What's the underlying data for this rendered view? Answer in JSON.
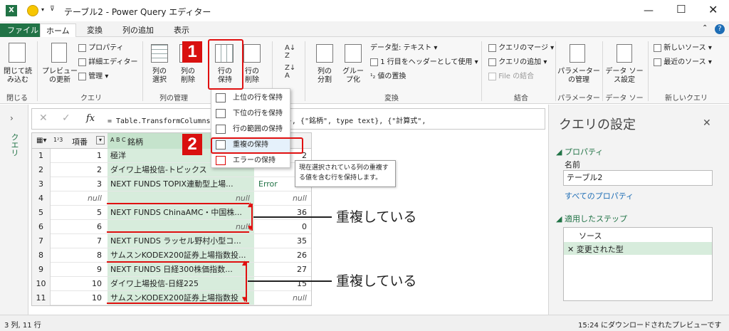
{
  "window": {
    "title": "テーブル2 - Power Query エディター"
  },
  "tabs": [
    "ファイル",
    "ホーム",
    "変換",
    "列の追加",
    "表示"
  ],
  "ribbon": {
    "close_load": "閉じて読\nみ込む",
    "preview": "プレビュー\nの更新",
    "properties": "プロパティ",
    "advanced_editor": "詳細エディター",
    "manage": "管理",
    "choose_cols": "列の\n選択",
    "remove_cols": "列の\n削除",
    "keep_rows": "行の\n保持",
    "remove_rows": "行の\n削除",
    "split_col": "列の\n分割",
    "group_by": "グルー\nプ化",
    "data_type": "データ型: テキスト",
    "first_row_header": "1 行目をヘッダーとして使用",
    "replace_values": "値の置換",
    "merge_queries": "クエリのマージ",
    "append_queries": "クエリの追加",
    "combine_files": "File の結合",
    "param_manage": "パラメーター\nの管理",
    "data_source": "データ ソー\nス設定",
    "new_source": "新しいソース",
    "recent_sources": "最近のソース",
    "groups": {
      "close": "閉じる",
      "query": "クエリ",
      "col_manage": "列の管理",
      "transform": "変換",
      "combine": "結合",
      "param": "パラメーター",
      "datasource": "データ ソース",
      "newquery": "新しいクエリ"
    }
  },
  "formula": {
    "fx": "fx",
    "text": "= Table.TransformColumns(... \", Int64.Type}, {\"銘柄\", type text}, {\"計算式\","
  },
  "nav_label": "クエリ",
  "grid": {
    "headers": [
      "項番",
      "銘柄"
    ],
    "header_types": [
      "1²3",
      "A B C"
    ],
    "rows": [
      {
        "num": "1",
        "c1": "1",
        "c2": "極洋",
        "c3": "2"
      },
      {
        "num": "2",
        "c1": "2",
        "c2": "ダイワ上場投信-トピックス",
        "c3": ""
      },
      {
        "num": "3",
        "c1": "3",
        "c2": "NEXT FUNDS TOPIX連動型上場...",
        "c3": "Error"
      },
      {
        "num": "4",
        "c1": "null",
        "c2": "null",
        "c3": "null"
      },
      {
        "num": "5",
        "c1": "5",
        "c2": "NEXT FUNDS ChinaAMC・中国株...",
        "c3": "36"
      },
      {
        "num": "6",
        "c1": "6",
        "c2": "null",
        "c3": "0"
      },
      {
        "num": "7",
        "c1": "7",
        "c2": "NEXT FUNDS ラッセル野村小型コ...",
        "c3": "35"
      },
      {
        "num": "8",
        "c1": "8",
        "c2": "サムスンKODEX200証券上場指数投...",
        "c3": "26"
      },
      {
        "num": "9",
        "c1": "9",
        "c2": "NEXT FUNDS 日経300株価指数...",
        "c3": "27"
      },
      {
        "num": "10",
        "c1": "10",
        "c2": "ダイワ上場投信-日経225",
        "c3": "15"
      },
      {
        "num": "11",
        "c1": "10",
        "c2": "サムスンKODEX200証券上場指数投",
        "c3": "null"
      }
    ]
  },
  "menu": {
    "items": [
      "上位の行を保持",
      "下位の行を保持",
      "行の範囲の保持",
      "重複の保持",
      "エラーの保持"
    ],
    "tooltip": "現在選択されている列の重複す\nる値を含む行を保持します。"
  },
  "annotations": {
    "badge1": "1",
    "badge2": "2",
    "dup1": "重複している",
    "dup2": "重複している"
  },
  "query_settings": {
    "title": "クエリの設定",
    "properties": "プロパティ",
    "name_label": "名前",
    "name_value": "テーブル2",
    "all_props": "すべてのプロパティ",
    "applied_steps": "適用したステップ",
    "steps": [
      "ソース",
      "変更された型"
    ]
  },
  "status": {
    "left": "3 列, 11 行",
    "right": "15:24 にダウンロードされたプレビューです"
  },
  "colors": {
    "accent": "#217346",
    "highlight": "#e01010",
    "selected_col": "#d7ecdc",
    "link": "#1d6db5"
  }
}
